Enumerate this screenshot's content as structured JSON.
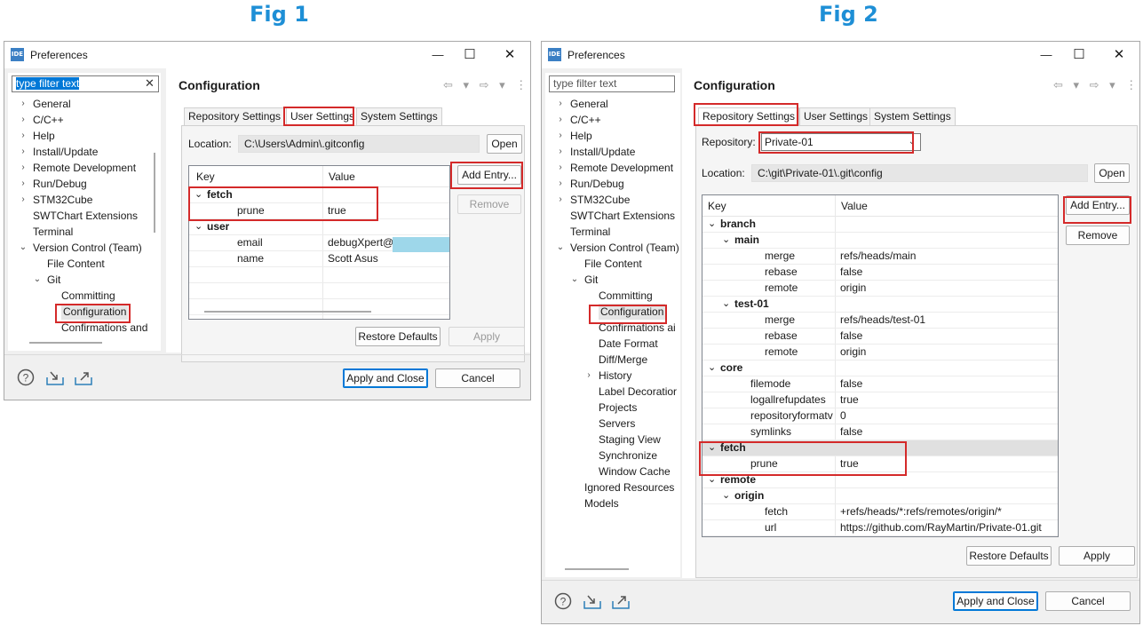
{
  "figures": {
    "fig1_title": "Fig 1",
    "fig2_title": "Fig 2"
  },
  "window_title": "Preferences",
  "ide_icon": "IDE",
  "window_controls": {
    "minimize": "—",
    "maximize": "☐",
    "close": "✕"
  },
  "filter_placeholder": "type filter text",
  "page_title": "Configuration",
  "nav_icons": "⇦ ▾ ⇨ ▾ ⋮",
  "tabs": {
    "repository": "Repository Settings",
    "user": "User Settings",
    "system": "System Settings"
  },
  "location_label": "Location:",
  "repository_label": "Repository:",
  "buttons": {
    "open": "Open",
    "add_entry": "Add Entry...",
    "remove": "Remove",
    "restore_defaults": "Restore Defaults",
    "apply": "Apply",
    "apply_and_close": "Apply and Close",
    "cancel": "Cancel"
  },
  "table_headers": {
    "key": "Key",
    "value": "Value"
  },
  "fig1": {
    "tree": [
      {
        "label": "General",
        "twisty": "›"
      },
      {
        "label": "C/C++",
        "twisty": "›"
      },
      {
        "label": "Help",
        "twisty": "›"
      },
      {
        "label": "Install/Update",
        "twisty": "›"
      },
      {
        "label": "Remote Development",
        "twisty": "›"
      },
      {
        "label": "Run/Debug",
        "twisty": "›"
      },
      {
        "label": "STM32Cube",
        "twisty": "›"
      },
      {
        "label": "SWTChart Extensions",
        "twisty": ""
      },
      {
        "label": "Terminal",
        "twisty": ""
      },
      {
        "label": "Version Control (Team)",
        "twisty": "⌄"
      },
      {
        "label": "File Content",
        "twisty": ""
      },
      {
        "label": "Git",
        "twisty": "⌄"
      },
      {
        "label": "Committing",
        "twisty": ""
      },
      {
        "label": "Configuration",
        "twisty": ""
      },
      {
        "label": "Confirmations and",
        "twisty": ""
      }
    ],
    "location": "C:\\Users\\Admin\\.gitconfig",
    "rows": [
      {
        "key": "fetch",
        "value": "",
        "twisty": "⌄"
      },
      {
        "key": "prune",
        "value": "true",
        "twisty": ""
      },
      {
        "key": "user",
        "value": "",
        "twisty": "⌄"
      },
      {
        "key": "email",
        "value": "debugXpert@",
        "twisty": ""
      },
      {
        "key": "name",
        "value": "Scott Asus",
        "twisty": ""
      }
    ]
  },
  "fig2": {
    "tree": [
      {
        "label": "General",
        "twisty": "›"
      },
      {
        "label": "C/C++",
        "twisty": "›"
      },
      {
        "label": "Help",
        "twisty": "›"
      },
      {
        "label": "Install/Update",
        "twisty": "›"
      },
      {
        "label": "Remote Development",
        "twisty": "›"
      },
      {
        "label": "Run/Debug",
        "twisty": "›"
      },
      {
        "label": "STM32Cube",
        "twisty": "›"
      },
      {
        "label": "SWTChart Extensions",
        "twisty": ""
      },
      {
        "label": "Terminal",
        "twisty": ""
      },
      {
        "label": "Version Control (Team)",
        "twisty": "⌄"
      },
      {
        "label": "File Content",
        "twisty": ""
      },
      {
        "label": "Git",
        "twisty": "⌄"
      },
      {
        "label": "Committing",
        "twisty": ""
      },
      {
        "label": "Configuration",
        "twisty": ""
      },
      {
        "label": "Confirmations ai",
        "twisty": ""
      },
      {
        "label": "Date Format",
        "twisty": ""
      },
      {
        "label": "Diff/Merge",
        "twisty": ""
      },
      {
        "label": "History",
        "twisty": "›"
      },
      {
        "label": "Label Decoratior",
        "twisty": ""
      },
      {
        "label": "Projects",
        "twisty": ""
      },
      {
        "label": "Servers",
        "twisty": ""
      },
      {
        "label": "Staging View",
        "twisty": ""
      },
      {
        "label": "Synchronize",
        "twisty": ""
      },
      {
        "label": "Window Cache",
        "twisty": ""
      },
      {
        "label": "Ignored Resources",
        "twisty": ""
      },
      {
        "label": "Models",
        "twisty": ""
      }
    ],
    "repository": "Private-01",
    "location": "C:\\git\\Private-01\\.git\\config",
    "rows": [
      {
        "key": "branch",
        "value": "",
        "twisty": "⌄"
      },
      {
        "key": "main",
        "value": "",
        "twisty": "⌄"
      },
      {
        "key": "merge",
        "value": "refs/heads/main",
        "twisty": ""
      },
      {
        "key": "rebase",
        "value": "false",
        "twisty": ""
      },
      {
        "key": "remote",
        "value": "origin",
        "twisty": ""
      },
      {
        "key": "test-01",
        "value": "",
        "twisty": "⌄"
      },
      {
        "key": "merge",
        "value": "refs/heads/test-01",
        "twisty": ""
      },
      {
        "key": "rebase",
        "value": "false",
        "twisty": ""
      },
      {
        "key": "remote",
        "value": "origin",
        "twisty": ""
      },
      {
        "key": "core",
        "value": "",
        "twisty": "⌄"
      },
      {
        "key": "filemode",
        "value": "false",
        "twisty": ""
      },
      {
        "key": "logallrefupdates",
        "value": "true",
        "twisty": ""
      },
      {
        "key": "repositoryformatversi",
        "value": "0",
        "twisty": ""
      },
      {
        "key": "symlinks",
        "value": "false",
        "twisty": ""
      },
      {
        "key": "fetch",
        "value": "",
        "twisty": "⌄"
      },
      {
        "key": "prune",
        "value": "true",
        "twisty": ""
      },
      {
        "key": "remote",
        "value": "",
        "twisty": "⌄"
      },
      {
        "key": "origin",
        "value": "",
        "twisty": "⌄"
      },
      {
        "key": "fetch",
        "value": "+refs/heads/*:refs/remotes/origin/*",
        "twisty": ""
      },
      {
        "key": "url",
        "value": "https://github.com/RayMartin/Private-01.git",
        "twisty": ""
      }
    ]
  },
  "icons": {
    "help": "help-icon",
    "import": "import-icon",
    "export": "export-icon"
  },
  "colors": {
    "highlight_box": "#d42a2a",
    "fig_title": "#1e8fd6",
    "selection": "#0078d7"
  }
}
